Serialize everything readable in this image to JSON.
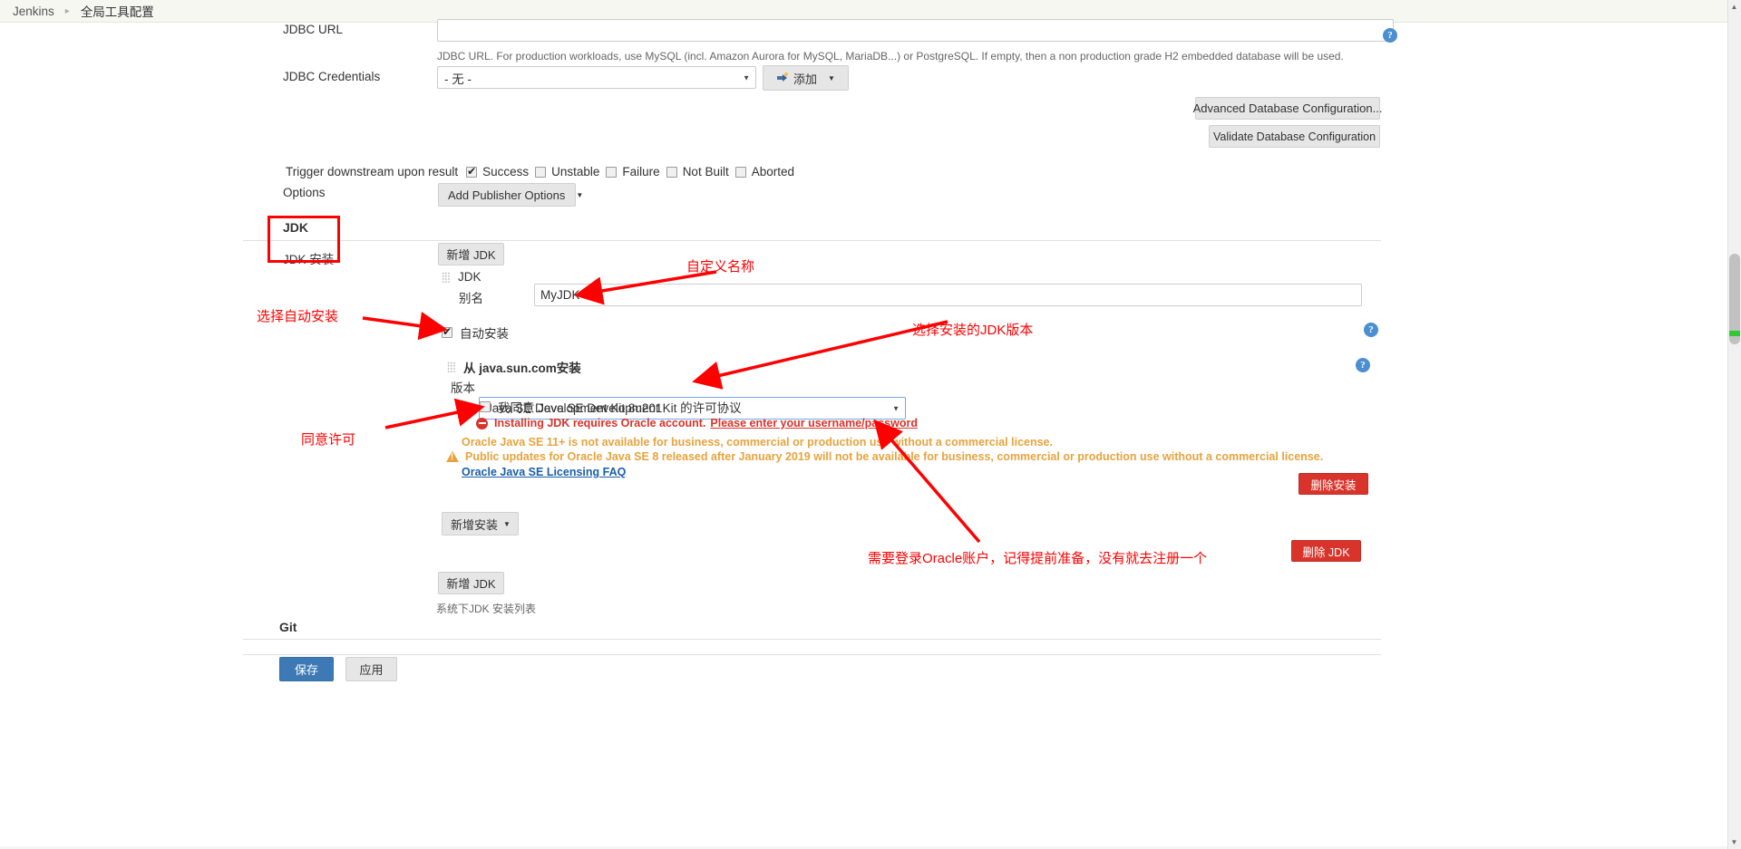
{
  "breadcrumb": {
    "items": [
      {
        "label": "Jenkins"
      },
      {
        "label": "全局工具配置"
      }
    ],
    "separator": "▸"
  },
  "database": {
    "jdbc_url_label": "JDBC URL",
    "jdbc_url_value": "",
    "jdbc_url_desc": "JDBC URL. For production workloads, use MySQL (incl. Amazon Aurora for MySQL, MariaDB...) or PostgreSQL. If empty, then a non production grade H2 embedded database will be used.",
    "jdbc_credentials_label": "JDBC Credentials",
    "jdbc_credentials_value": "- 无 -",
    "add_credentials_label": "添加",
    "advanced_db_config_label": "Advanced Database Configuration...",
    "validate_db_config_label": "Validate Database Configuration",
    "help_icon": "help-icon"
  },
  "trigger": {
    "label": "Trigger downstream upon result",
    "checkboxes": [
      {
        "label": "Success",
        "checked": true
      },
      {
        "label": "Unstable",
        "checked": false
      },
      {
        "label": "Failure",
        "checked": false
      },
      {
        "label": "Not Built",
        "checked": false
      },
      {
        "label": "Aborted",
        "checked": false
      }
    ],
    "options_label": "Options",
    "add_publisher_options_label": "Add Publisher Options",
    "caret": "▼"
  },
  "jdk": {
    "section_title": "JDK",
    "install_label": "JDK 安装",
    "add_jdk_label": "新增 JDK",
    "item_title": "JDK",
    "alias_label": "别名",
    "alias_value": "MyJDK",
    "auto_install_label": "自动安装",
    "auto_install_checked": true,
    "installer_title": "从 java.sun.com安装",
    "version_label": "版本",
    "version_value": "Java SE Development Kit 8u201",
    "license_agree_label": "我同意 Java SE Development Kit 的许可协议",
    "license_agree_checked": false,
    "error_prefix": "Installing JDK requires Oracle account.",
    "error_link": "Please enter your username/password",
    "warn_1": "Oracle Java SE 11+ is not available for business, commercial or production use without a commercial license.",
    "warn_2": "Public updates for Oracle Java SE 8 released after January 2019 will not be available for business, commercial or production use without a commercial license.",
    "licensing_faq_link": "Oracle Java SE Licensing FAQ",
    "delete_install_label": "删除安装",
    "add_install_label": "新增安装",
    "delete_jdk_label": "删除 JDK",
    "add_jdk_label_2": "新增 JDK",
    "list_hint": "系统下JDK 安装列表",
    "caret": "▼"
  },
  "git": {
    "section_title": "Git"
  },
  "footer": {
    "save_label": "保存",
    "apply_label": "应用"
  },
  "annotations": {
    "custom_name": "自定义名称",
    "choose_auto_install": "选择自动安装",
    "choose_jdk_version": "选择安装的JDK版本",
    "agree_license": "同意许可",
    "oracle_account": "需要登录Oracle账户，记得提前准备，没有就去注册一个",
    "color": "#ff0000"
  }
}
